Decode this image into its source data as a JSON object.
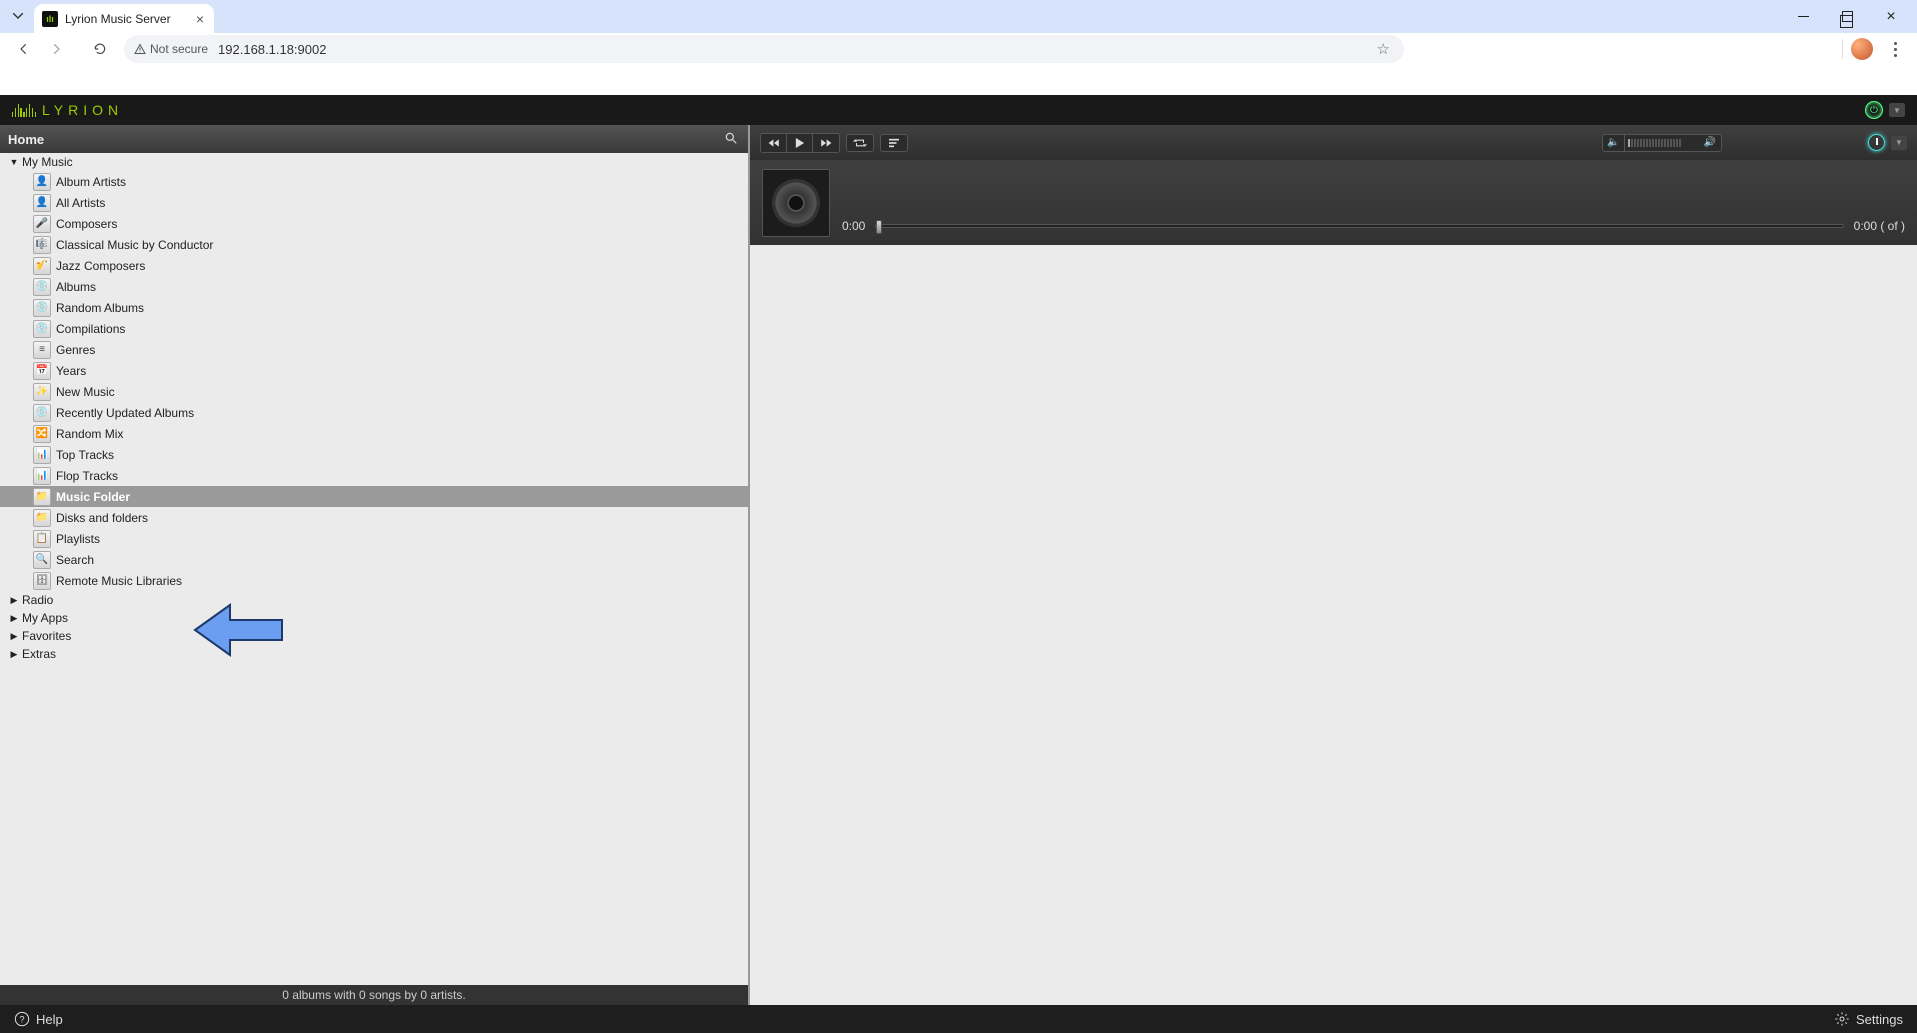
{
  "browser": {
    "tab_title": "Lyrion Music Server",
    "not_secure": "Not secure",
    "url": "192.168.1.18:9002"
  },
  "appbar": {
    "brand": "LYRION"
  },
  "left": {
    "crumb": "Home",
    "status": "0 albums with 0 songs by 0 artists."
  },
  "tree": {
    "my_music": "My Music",
    "items": [
      {
        "label": "Album Artists",
        "glyph": "👤"
      },
      {
        "label": "All Artists",
        "glyph": "👤"
      },
      {
        "label": "Composers",
        "glyph": "🎤"
      },
      {
        "label": "Classical Music by Conductor",
        "glyph": "🎼"
      },
      {
        "label": "Jazz Composers",
        "glyph": "🎷"
      },
      {
        "label": "Albums",
        "glyph": "💿"
      },
      {
        "label": "Random Albums",
        "glyph": "💿"
      },
      {
        "label": "Compilations",
        "glyph": "💿"
      },
      {
        "label": "Genres",
        "glyph": "≡"
      },
      {
        "label": "Years",
        "glyph": "📅"
      },
      {
        "label": "New Music",
        "glyph": "✨"
      },
      {
        "label": "Recently Updated Albums",
        "glyph": "💿"
      },
      {
        "label": "Random Mix",
        "glyph": "🔀"
      },
      {
        "label": "Top Tracks",
        "glyph": "📊"
      },
      {
        "label": "Flop Tracks",
        "glyph": "📊"
      },
      {
        "label": "Music Folder",
        "glyph": "📁"
      },
      {
        "label": "Disks and folders",
        "glyph": "📁"
      },
      {
        "label": "Playlists",
        "glyph": "📋"
      },
      {
        "label": "Search",
        "glyph": "🔍"
      },
      {
        "label": "Remote Music Libraries",
        "glyph": "🗄"
      }
    ],
    "radio": "Radio",
    "my_apps": "My Apps",
    "favorites": "Favorites",
    "extras": "Extras"
  },
  "player": {
    "elapsed": "0:00",
    "remaining": "0:00  ( of )"
  },
  "footer": {
    "help": "Help",
    "settings": "Settings"
  }
}
